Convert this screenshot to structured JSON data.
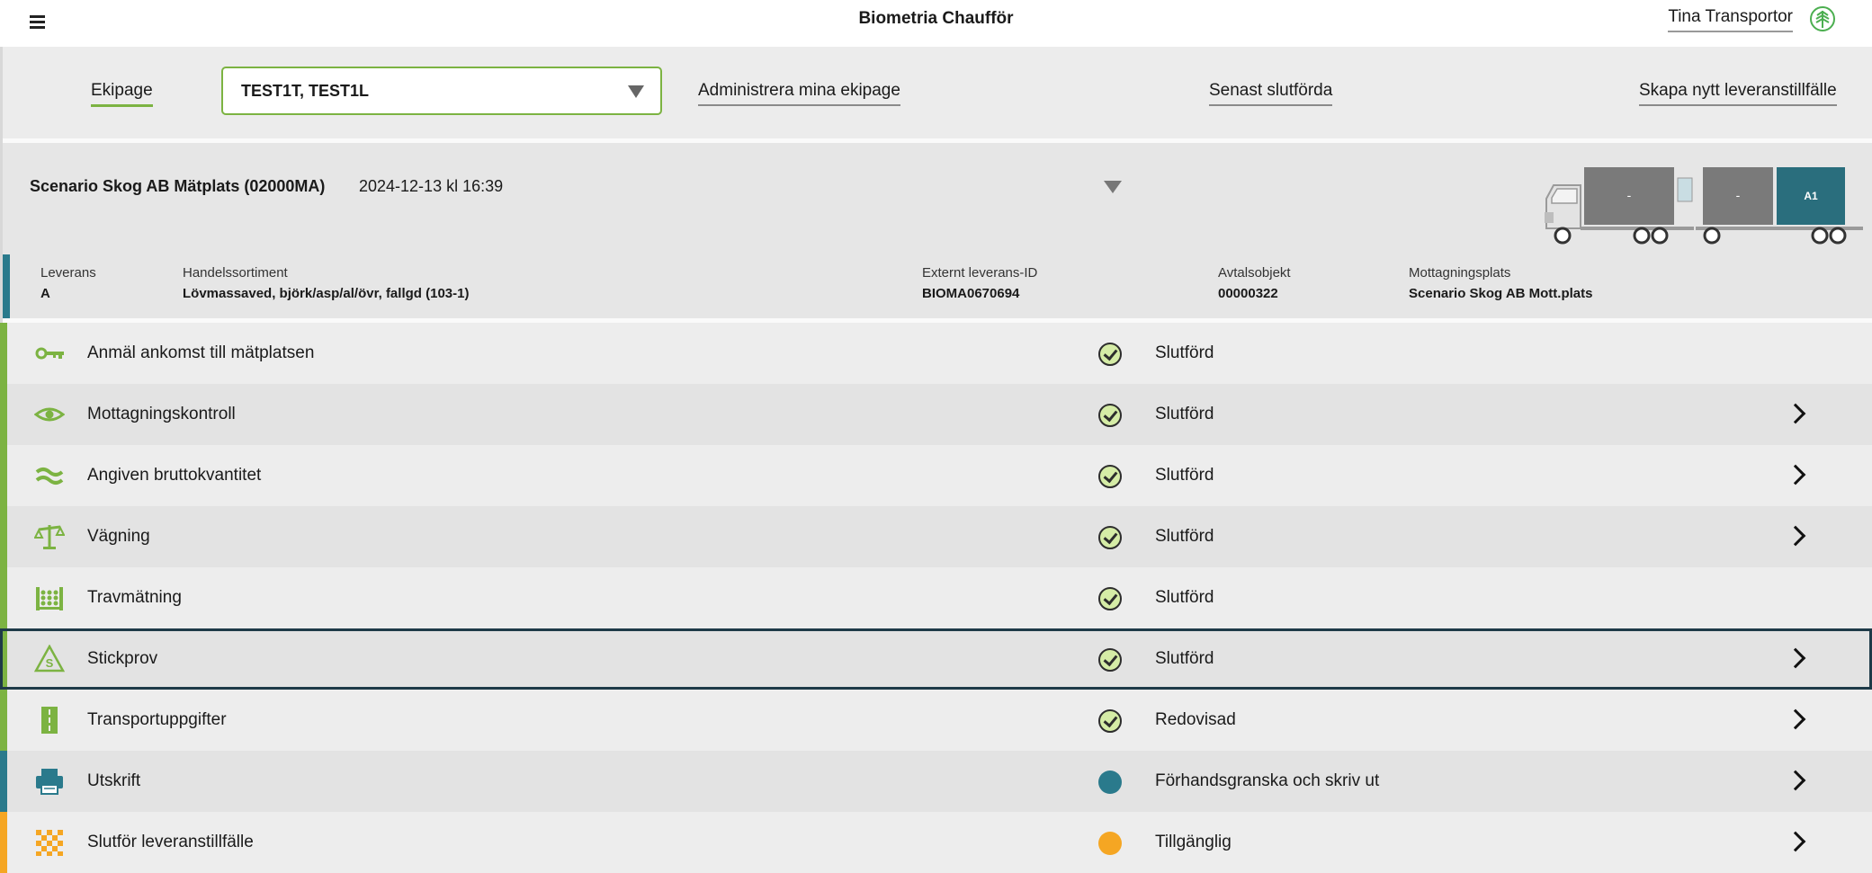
{
  "header": {
    "app_title": "Biometria Chaufför",
    "user_name": "Tina Transportor"
  },
  "toolbar": {
    "ekipage_label": "Ekipage",
    "ekipage_selected": "TEST1T, TEST1L",
    "manage_link": "Administrera mina ekipage",
    "recent_link": "Senast slutförda",
    "create_link": "Skapa nytt leveranstillfälle"
  },
  "summary": {
    "place": "Scenario Skog AB Mätplats (02000MA)",
    "datetime": "2024-12-13 kl 16:39",
    "truck": {
      "cargo1": "-",
      "cargo2": "-",
      "cargo3": "A1"
    }
  },
  "delivery": {
    "leverans": {
      "label": "Leverans",
      "value": "A"
    },
    "sortiment": {
      "label": "Handelssortiment",
      "value": "Lövmassaved, björk/asp/al/övr, fallgd (103-1)"
    },
    "extern_id": {
      "label": "Externt leverans-ID",
      "value": "BIOMA0670694"
    },
    "avtal": {
      "label": "Avtalsobjekt",
      "value": "00000322"
    },
    "mottagning": {
      "label": "Mottagningsplats",
      "value": "Scenario Skog AB Mott.plats"
    }
  },
  "steps": [
    {
      "label": "Anmäl ankomst till mätplatsen",
      "status": "Slutförd",
      "icon": "key-icon",
      "has_chevron": false
    },
    {
      "label": "Mottagningskontroll",
      "status": "Slutförd",
      "icon": "eye-icon",
      "has_chevron": true
    },
    {
      "label": "Angiven bruttokvantitet",
      "status": "Slutförd",
      "icon": "approx-icon",
      "has_chevron": true
    },
    {
      "label": "Vägning",
      "status": "Slutförd",
      "icon": "scale-icon",
      "has_chevron": true
    },
    {
      "label": "Travmätning",
      "status": "Slutförd",
      "icon": "timber-stack-icon",
      "has_chevron": false
    },
    {
      "label": "Stickprov",
      "status": "Slutförd",
      "icon": "sample-icon",
      "has_chevron": true
    },
    {
      "label": "Transportuppgifter",
      "status": "Redovisad",
      "icon": "road-icon",
      "has_chevron": true
    },
    {
      "label": "Utskrift",
      "status": "Förhandsgranska och skriv ut",
      "icon": "printer-icon",
      "has_chevron": true
    },
    {
      "label": "Slutför leveranstillfälle",
      "status": "Tillgänglig",
      "icon": "checkered-flag-icon",
      "has_chevron": true
    }
  ],
  "colors": {
    "green": "#7cb342",
    "teal": "#2a7a8c",
    "orange": "#f5a623",
    "check_fill": "#d5eca6"
  }
}
